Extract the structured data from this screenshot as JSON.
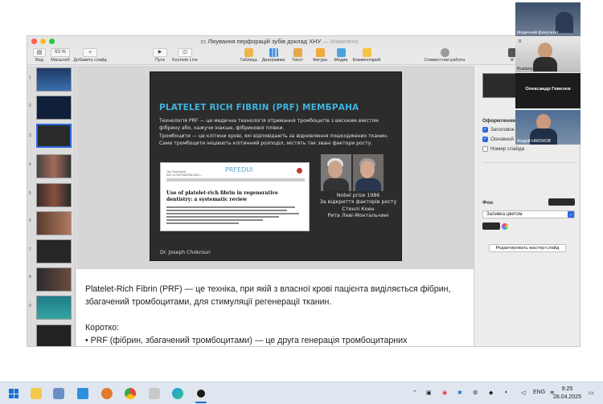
{
  "window": {
    "title": "Лікування перфорацій зубів доклад ХНУ",
    "edited": "— Изменено"
  },
  "toolbar": {
    "view": "Вид",
    "zoom_value": "63 %",
    "zoom": "Масштаб",
    "add_slide": "Добавить слайд",
    "play": "Пуск",
    "keynote_live": "Keynote Live",
    "table": "Таблица",
    "chart": "Диаграмма",
    "text": "Текст",
    "shape": "Фигура",
    "media": "Медиа",
    "comment": "Комментарий",
    "collaborate": "Совместная работа",
    "format": "Ф"
  },
  "navigator": {
    "numbers": [
      "1",
      "2",
      "3",
      "4",
      "5",
      "6",
      "7",
      "8",
      "9"
    ]
  },
  "slide": {
    "title": "PLATELET RICH FIBRIN (PRF) МЕМБРАНА",
    "para1": [
      "Технологія PRF — це медична технологія отримання тромбоцитів з високим вмістом",
      "фібрину або, кажучи інакше, фібринової плівки."
    ],
    "para2": [
      "Тромбоцити — це клітини крові, які відповідають за відновлення пошкоджених тканин.",
      "Саме тромбоцити ініціюють клітинний розподіл, містять так звані фактори росту."
    ],
    "paper": {
      "brand": "PRFEDUI",
      "journal": [
        "Clin Oral Invest",
        "DOI 10.1007/s00784-016-1..."
      ],
      "heading": "Use of platelet-rich fibrin in regenerative dentistry: a systematic review"
    },
    "nobel": [
      "Nobel prize 1986",
      "За відкриття факторів росту",
      "Стенлі Коен",
      "Рита Леві-Монтальчині"
    ],
    "footer": "Dr. Joseph Chokroun"
  },
  "notes": {
    "lines": [
      "Platelet-Rich Fibrin (PRF) — це техніка, при якій з власної крові пацієнта виділяється фібрин,",
      "збагачений тромбоцитами, для стимуляції регенерації тканин.",
      "Коротко:",
      "• PRF (фібрин, збагачений тромбоцитами) — це друга генерація тромбоцитарних"
    ]
  },
  "inspector": {
    "design": "Оформление",
    "opt1": "Заголовок",
    "opt2": "Основной т",
    "opt3": "Номер слайда",
    "bg_head": "Фон",
    "fill": "Заливка цветом",
    "edit_master": "Редактировать мастер-слайд"
  },
  "video": {
    "t1": "Медичний факультет",
    "t2": "Ruslana Kovach",
    "t2_short": "R",
    "t3": "Олександр Гевелєв",
    "t4": "Андрій НІКОНОВ"
  },
  "taskbar": {
    "lang": "ENG",
    "time": "9:25",
    "date": "28.04.2025"
  }
}
